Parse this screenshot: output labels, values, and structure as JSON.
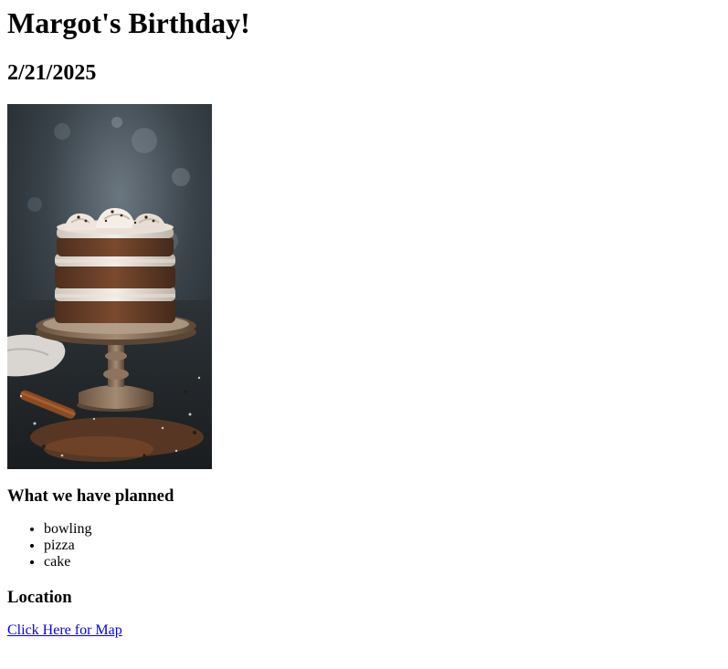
{
  "page": {
    "title": "Margot's Birthday!",
    "date": "2/21/2025"
  },
  "image": {
    "subject": "layered birthday cake on wooden cake stand",
    "icon": "cake-photo"
  },
  "plans": {
    "heading": "What we have planned",
    "items": [
      "bowling",
      "pizza",
      "cake"
    ]
  },
  "location": {
    "heading": "Location",
    "link_label": "Click Here for Map"
  },
  "colors": {
    "link": "#0000ee",
    "text": "#000000",
    "background": "#ffffff"
  }
}
